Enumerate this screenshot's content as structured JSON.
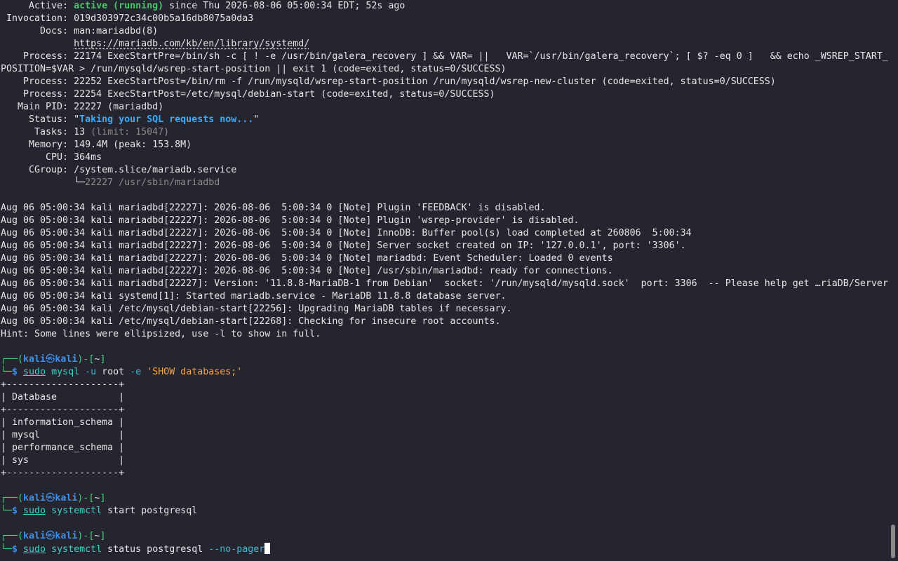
{
  "status_block": {
    "active_label": "     Active: ",
    "active_state": "active (running)",
    "active_rest": " since Thu 2026-08-06 05:00:34 EDT; 52s ago",
    "invocation": " Invocation: 019d303972c34c00b5a16db8075a0da3",
    "docs_label": "       Docs: ",
    "docs_man": "man:mariadbd(8)",
    "docs_indent": "             ",
    "docs_url": "https://mariadb.com/kb/en/library/systemd/",
    "process1a": "    Process: 22174 ExecStartPre=/bin/sh -c [ ! -e /usr/bin/galera_recovery ] && VAR= ||   VAR=`/usr/bin/galera_recovery`; [ $? -eq 0 ]   && echo _WSREP_START_",
    "process1b": "POSITION=$VAR > /run/mysqld/wsrep-start-position || exit 1 (code=exited, status=0/SUCCESS)",
    "process2": "    Process: 22252 ExecStartPost=/bin/rm -f /run/mysqld/wsrep-start-position /run/mysqld/wsrep-new-cluster (code=exited, status=0/SUCCESS)",
    "process3": "    Process: 22254 ExecStartPost=/etc/mysql/debian-start (code=exited, status=0/SUCCESS)",
    "main_pid": "   Main PID: 22227 (mariadbd)",
    "status_label": "     Status: \"",
    "status_msg": "Taking your SQL requests now...",
    "status_end": "\"",
    "tasks_label": "      Tasks: 13 ",
    "tasks_limit": "(limit: 15047)",
    "memory": "     Memory: 149.4M (peak: 153.8M)",
    "cpu": "        CPU: 364ms",
    "cgroup": "     CGroup: /system.slice/mariadb.service",
    "cgroup_tree_branch": "             └─",
    "cgroup_tree_proc": "22227 /usr/sbin/mariadbd"
  },
  "log_lines": [
    "Aug 06 05:00:34 kali mariadbd[22227]: 2026-08-06  5:00:34 0 [Note] Plugin 'FEEDBACK' is disabled.",
    "Aug 06 05:00:34 kali mariadbd[22227]: 2026-08-06  5:00:34 0 [Note] Plugin 'wsrep-provider' is disabled.",
    "Aug 06 05:00:34 kali mariadbd[22227]: 2026-08-06  5:00:34 0 [Note] InnoDB: Buffer pool(s) load completed at 260806  5:00:34",
    "Aug 06 05:00:34 kali mariadbd[22227]: 2026-08-06  5:00:34 0 [Note] Server socket created on IP: '127.0.0.1', port: '3306'.",
    "Aug 06 05:00:34 kali mariadbd[22227]: 2026-08-06  5:00:34 0 [Note] mariadbd: Event Scheduler: Loaded 0 events",
    "Aug 06 05:00:34 kali mariadbd[22227]: 2026-08-06  5:00:34 0 [Note] /usr/sbin/mariadbd: ready for connections.",
    "Aug 06 05:00:34 kali mariadbd[22227]: Version: '11.8.8-MariaDB-1 from Debian'  socket: '/run/mysqld/mysqld.sock'  port: 3306  -- Please help get …riaDB/Server",
    "Aug 06 05:00:34 kali systemd[1]: Started mariadb.service - MariaDB 11.8.8 database server.",
    "Aug 06 05:00:34 kali /etc/mysql/debian-start[22256]: Upgrading MariaDB tables if necessary.",
    "Aug 06 05:00:34 kali /etc/mysql/debian-start[22268]: Checking for insecure root accounts.",
    "Hint: Some lines were ellipsized, use -l to show in full."
  ],
  "prompt": {
    "top_left": "┌──(",
    "user": "kali",
    "skull": "㉿",
    "host": "kali",
    "mid": ")-[",
    "dir": "~",
    "end": "]",
    "bottom_left": "└─",
    "dollar": "$ "
  },
  "commands": [
    {
      "sudo": "sudo",
      "bin": "mysql",
      "args_plain": "root",
      "opt1": "-u ",
      "opt2": " -e ",
      "string": "'SHOW databases;'"
    },
    {
      "sudo": "sudo",
      "bin": "systemctl",
      "args_plain": " start postgresql"
    },
    {
      "sudo": "sudo",
      "bin": "systemctl",
      "args_plain": " status postgresql ",
      "opt": "--no-pager"
    }
  ],
  "db_table": {
    "border": "+--------------------+",
    "header": "| Database           |",
    "rows": [
      "| information_schema |",
      "| mysql              |",
      "| performance_schema |",
      "| sys                |"
    ]
  },
  "colors": {
    "background": "#24252e",
    "prompt_green": "#3fd17b",
    "prompt_blue": "#3f8fe6",
    "active_green": "#4ec46f",
    "status_blue": "#3fa9f5",
    "string_orange": "#f6a54c"
  }
}
